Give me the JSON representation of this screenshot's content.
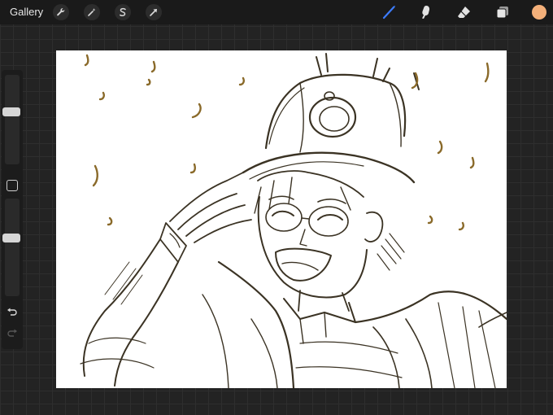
{
  "topbar": {
    "gallery_label": "Gallery",
    "left_tools": [
      "wrench-icon",
      "magic-wand-icon",
      "selection-s-icon",
      "transform-arrow-icon"
    ],
    "right_tools": [
      "brush-icon",
      "smudge-icon",
      "eraser-icon",
      "layers-icon"
    ],
    "active_tool": "brush-icon",
    "current_color": "#f4b07a",
    "active_color": "#3d7cff"
  },
  "sidebar": {
    "brush_size_level": 0.33,
    "opacity_level": 0.35
  },
  "canvas": {
    "background": "#ffffff",
    "stroke_color": "#3b3324",
    "accent_stroke_color": "#8a6a2a"
  }
}
